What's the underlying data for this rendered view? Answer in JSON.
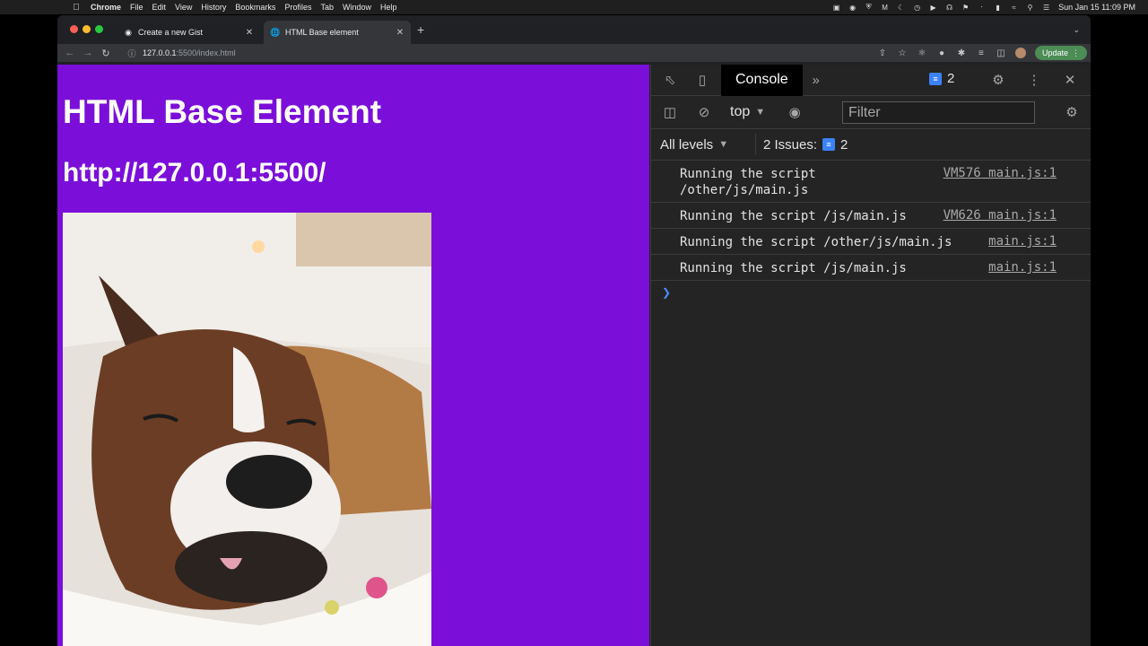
{
  "menubar": {
    "app_name": "Chrome",
    "items": [
      "File",
      "Edit",
      "View",
      "History",
      "Bookmarks",
      "Profiles",
      "Tab",
      "Window",
      "Help"
    ],
    "clock": "Sun Jan 15  11:09 PM"
  },
  "browser": {
    "tabs": [
      {
        "title": "Create a new Gist",
        "active": false
      },
      {
        "title": "HTML Base element",
        "active": true
      }
    ],
    "url_host": "127.0.0.1",
    "url_path": ":5500/index.html",
    "update_label": "Update"
  },
  "page": {
    "heading": "HTML Base Element",
    "base_url": "http://127.0.0.1:5500/",
    "background": "#7b0fd9"
  },
  "devtools": {
    "active_tab": "Console",
    "message_count": "2",
    "context": "top",
    "filter_placeholder": "Filter",
    "levels_label": "All levels",
    "issues_label": "2 Issues:",
    "issues_count": "2",
    "logs": [
      {
        "message": "Running the script /other/js/main.js",
        "source": "VM576 main.js:1"
      },
      {
        "message": "Running the script /js/main.js",
        "source": "VM626 main.js:1"
      },
      {
        "message": "Running the script /other/js/main.js",
        "source": "main.js:1"
      },
      {
        "message": "Running the script /js/main.js",
        "source": "main.js:1"
      }
    ]
  }
}
